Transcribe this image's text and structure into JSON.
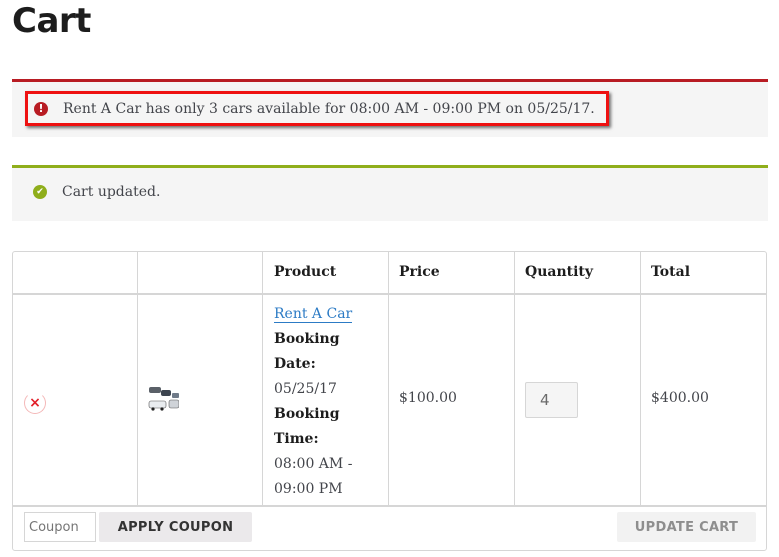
{
  "page": {
    "title": "Cart"
  },
  "notices": {
    "error": {
      "icon": "exclamation-icon",
      "text": "Rent A Car has only 3 cars available for 08:00 AM - 09:00 PM on 05/25/17.",
      "color": "#b81c23",
      "highlight_color": "#ee1111"
    },
    "success": {
      "icon": "check-icon",
      "text": "Cart updated.",
      "color": "#8fae1b"
    }
  },
  "cart": {
    "columns": [
      "",
      "",
      "Product",
      "Price",
      "Quantity",
      "Total"
    ],
    "items": [
      {
        "remove_icon": "×",
        "thumbnail": "car-thumbnail",
        "product_name": "Rent A Car",
        "meta": [
          {
            "label_1": "Booking",
            "label_2": "Date:",
            "value_1": "05/25/17",
            "value_2": ""
          },
          {
            "label_1": "Booking",
            "label_2": "Time:",
            "value_1": "08:00 AM -",
            "value_2": "09:00 PM"
          }
        ],
        "price": "$100.00",
        "quantity": "4",
        "total": "$400.00"
      }
    ],
    "coupon": {
      "placeholder": "Coupon"
    },
    "apply_coupon_label": "APPLY COUPON",
    "update_cart_label": "UPDATE CART",
    "link_color": "#2c7bc5"
  },
  "icons": {
    "error_glyph": "!",
    "success_glyph": "✔"
  }
}
